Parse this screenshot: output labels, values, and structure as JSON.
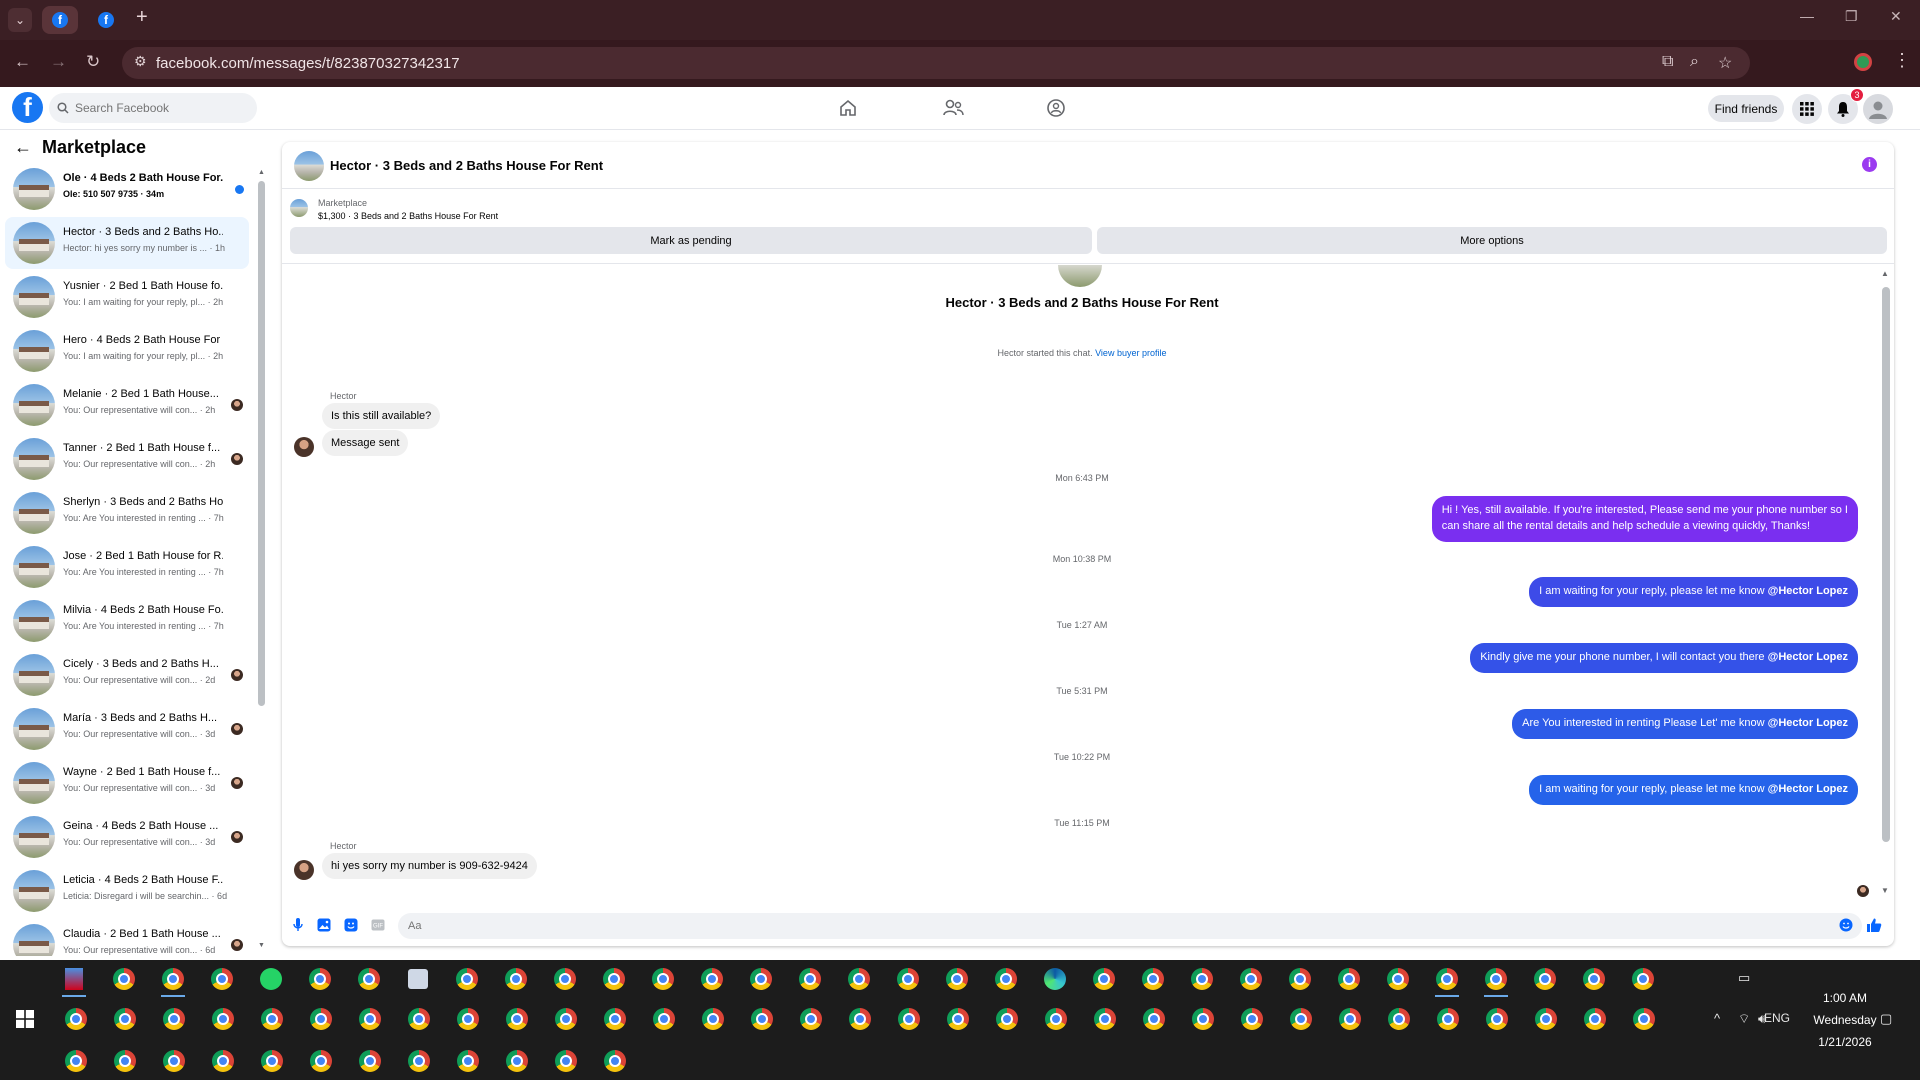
{
  "browser": {
    "url": "facebook.com/messages/t/823870327342317",
    "tabs": [
      {
        "favicon": "f"
      },
      {
        "favicon": "f"
      }
    ]
  },
  "header": {
    "logo": "f",
    "search_placeholder": "Search Facebook",
    "find_friends": "Find friends",
    "notification_count": "3"
  },
  "sidebar": {
    "title": "Marketplace",
    "conversations": [
      {
        "title": "Ole · 4 Beds 2 Bath House For...",
        "subtitle": "Ole: 510 507 9735 · 34m",
        "unread": true
      },
      {
        "title": "Hector · 3 Beds and 2 Baths Ho...",
        "subtitle": "Hector: hi yes sorry my number is ... · 1h",
        "active": true
      },
      {
        "title": "Yusnier · 2 Bed 1 Bath House fo...",
        "subtitle": "You: I am waiting for your reply, pl... · 2h"
      },
      {
        "title": "Hero · 4 Beds 2 Bath House For ...",
        "subtitle": "You: I am waiting for your reply, pl... · 2h"
      },
      {
        "title": "Melanie · 2 Bed 1 Bath House...",
        "subtitle": "You: Our representative will con... · 2h",
        "avatar": true
      },
      {
        "title": "Tanner · 2 Bed 1 Bath House f...",
        "subtitle": "You: Our representative will con... · 2h",
        "avatar": true
      },
      {
        "title": "Sherlyn · 3 Beds and 2 Baths Ho...",
        "subtitle": "You: Are You interested in renting ... · 7h"
      },
      {
        "title": "Jose · 2 Bed 1 Bath House for R...",
        "subtitle": "You: Are You interested in renting ... · 7h"
      },
      {
        "title": "Milvia · 4 Beds 2 Bath House Fo...",
        "subtitle": "You: Are You interested in renting ... · 7h"
      },
      {
        "title": "Cicely · 3 Beds and 2 Baths H...",
        "subtitle": "You: Our representative will con... · 2d",
        "avatar": true
      },
      {
        "title": "María · 3 Beds and 2 Baths H...",
        "subtitle": "You: Our representative will con... · 3d",
        "avatar": true
      },
      {
        "title": "Wayne · 2 Bed 1 Bath House f...",
        "subtitle": "You: Our representative will con... · 3d",
        "avatar": true
      },
      {
        "title": "Geina · 4 Beds 2 Bath House ...",
        "subtitle": "You: Our representative will con... · 3d",
        "avatar": true
      },
      {
        "title": "Leticia · 4 Beds 2 Bath House F...",
        "subtitle": "Leticia: Disregard i will be searchin... · 6d"
      },
      {
        "title": "Claudia · 2 Bed 1 Bath House ...",
        "subtitle": "You: Our representative will con... · 6d",
        "avatar": true
      }
    ]
  },
  "chat": {
    "title": "Hector · 3 Beds and 2 Baths House For Rent",
    "marketplace_label": "Marketplace",
    "listing": "$1,300 · 3 Beds and 2 Baths House For Rent",
    "mark_pending": "Mark as pending",
    "more_options": "More options",
    "started_text": "Hector started this chat.",
    "view_profile": "View buyer profile",
    "sender_name": "Hector",
    "incoming_1": "Is this still available?",
    "incoming_2": "Message sent",
    "timestamps": [
      "Mon 6:43 PM",
      "Mon 10:38 PM",
      "Tue 1:27 AM",
      "Tue 5:31 PM",
      "Tue 10:22 PM",
      "Tue 11:15 PM"
    ],
    "outgoing": [
      {
        "line1": "Hi ! Yes, still available. If you're interested, Please send me your phone number so I",
        "line2": "can share all the rental details and help schedule a viewing quickly, Thanks!"
      },
      {
        "text": "I am waiting for your reply, please let me know ",
        "mention": "@Hector Lopez"
      },
      {
        "text": "Kindly give me your phone number, I will contact you there ",
        "mention": "@Hector Lopez"
      },
      {
        "text": "Are You  interested in renting Please Let' me know ",
        "mention": "@Hector Lopez"
      },
      {
        "text": "I am waiting for your reply, please let me know ",
        "mention": "@Hector Lopez"
      }
    ],
    "incoming_3": "hi yes sorry my number is 909-632-9424",
    "composer_placeholder": "Aa"
  },
  "taskbar": {
    "time": "1:00 AM",
    "day": "Wednesday",
    "date": "1/21/2026",
    "lang": "ENG"
  },
  "colors": {
    "accent": "#1877f2",
    "bubble_purple": "#7a2ff0",
    "bubble_blue": "#2d5be8",
    "browser_frame": "#3b1f24"
  }
}
